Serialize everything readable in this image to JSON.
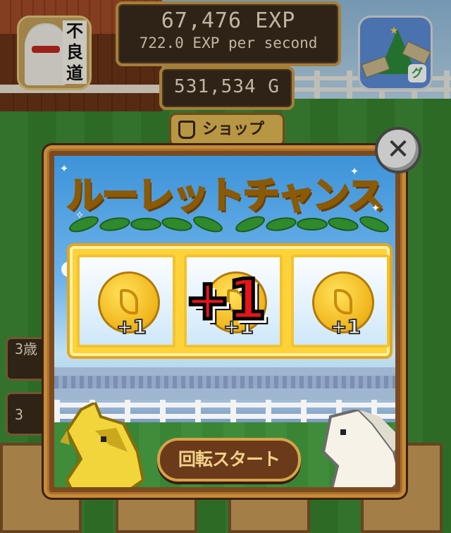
{
  "hud": {
    "exp_total": "67,476 EXP",
    "exp_rate": "722.0 EXP per second",
    "gold": "531,534  G",
    "shop_label": "ショップ"
  },
  "icons": {
    "left_app": "furyodo-app-icon",
    "left_app_text": "不良道",
    "right_app": "christmas-tree-money-icon",
    "right_app_badge": "グ"
  },
  "side_panels": [
    {
      "text": "3歳"
    },
    {
      "text": "3"
    }
  ],
  "popup": {
    "title": "ルーレットチャンス",
    "reels": [
      {
        "item": "gold-coin",
        "value": "+1"
      },
      {
        "item": "gold-coin",
        "value": "+1"
      },
      {
        "item": "gold-coin",
        "value": "+1"
      }
    ],
    "bonus_text": "+1",
    "start_button": "回転スタート",
    "close_icon": "close-icon"
  },
  "colors": {
    "title_yellow": "#ffe43a",
    "bonus_red": "#e8141a",
    "frame_gold": "#ffd23a",
    "button_brown": "#6b3a1a"
  }
}
